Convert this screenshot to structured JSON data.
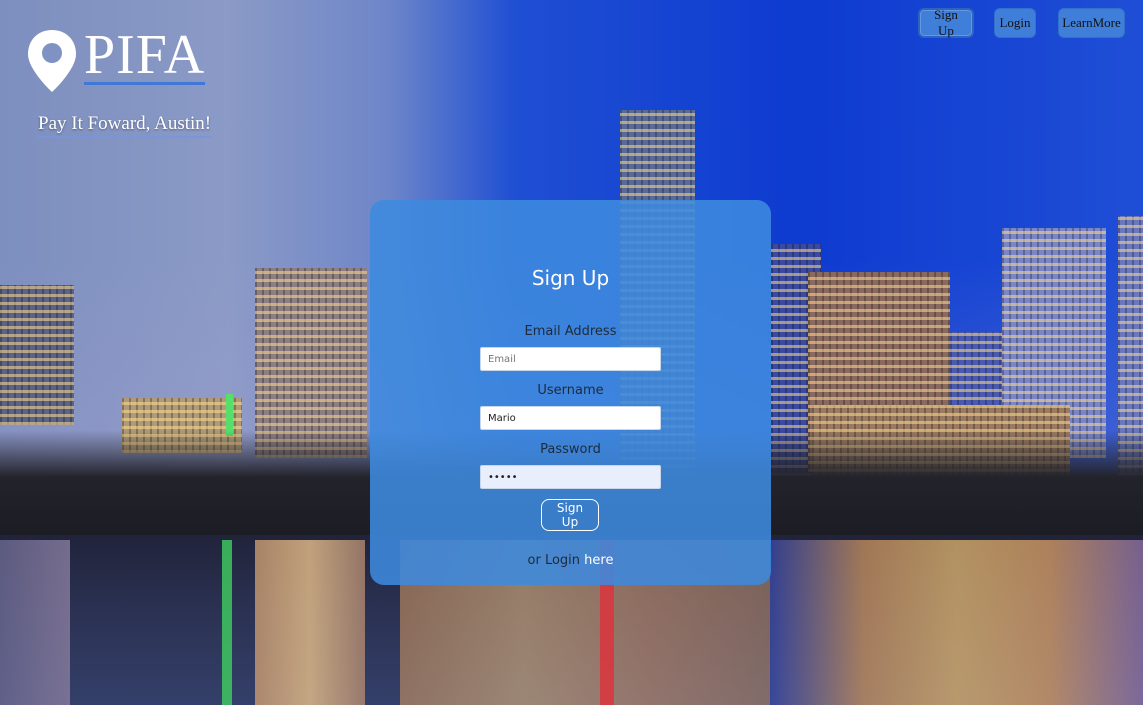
{
  "brand": {
    "title": "PIFA",
    "tagline": "Pay It Foward, Austin!"
  },
  "nav": {
    "signup_label": "Sign Up",
    "login_label": "Login",
    "learn_more_label": "LearnMore"
  },
  "form": {
    "title": "Sign Up",
    "email_label": "Email Address",
    "email_placeholder": "Email",
    "username_label": "Username",
    "username_value": "Mario",
    "password_label": "Password",
    "password_value": "•••••",
    "submit_label": "Sign Up",
    "alt_prefix": "or Login",
    "alt_link": "here"
  },
  "colors": {
    "accent": "#3f7fd9",
    "card": "#3d8ade"
  }
}
